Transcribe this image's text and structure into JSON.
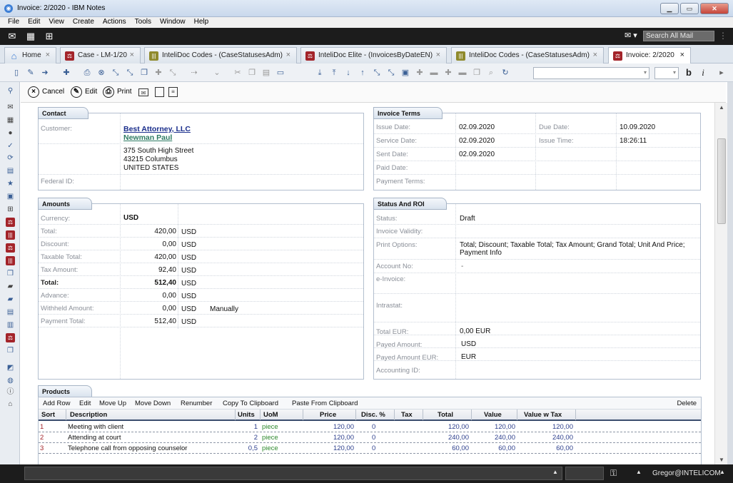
{
  "window": {
    "title": "Invoice: 2/2020 - IBM Notes",
    "buttons": [
      "▁",
      "▭",
      "✕"
    ]
  },
  "menu": [
    "File",
    "Edit",
    "View",
    "Create",
    "Actions",
    "Tools",
    "Window",
    "Help"
  ],
  "search": {
    "placeholder": "Search All Mail"
  },
  "tabs": [
    {
      "label": "Home",
      "icon": "home-icon"
    },
    {
      "label": "Case - LM-1/20",
      "icon": "case-icon"
    },
    {
      "label": "InteliDoc Codes - (CaseStatusesAdm)",
      "icon": "intelidoc-codes-icon"
    },
    {
      "label": "InteliDoc Elite - (InvoicesByDateEN)",
      "icon": "intelidoc-elite-icon"
    },
    {
      "label": "InteliDoc Codes - (CaseStatusesAdm)",
      "icon": "intelidoc-codes-icon"
    },
    {
      "label": "Invoice: 2/2020",
      "icon": "invoice-icon",
      "active": true
    }
  ],
  "format": {
    "bold": "b",
    "italic": "i"
  },
  "actions": {
    "cancel": "Cancel",
    "edit": "Edit",
    "print": "Print"
  },
  "contact": {
    "title": "Contact",
    "customer_label": "Customer:",
    "company": "Best Attorney, LLC",
    "person": "Newman Paul",
    "address1": "375 South High Street",
    "address2": "43215  Columbus",
    "country": "UNITED STATES",
    "federal_label": "Federal ID:"
  },
  "invoice_terms": {
    "title": "Invoice Terms",
    "issue_date_label": "Issue Date:",
    "issue_date": "02.09.2020",
    "due_date_label": "Due Date:",
    "due_date": "10.09.2020",
    "service_date_label": "Service Date:",
    "service_date": "02.09.2020",
    "issue_time_label": "Issue Time:",
    "issue_time": "18:26:11",
    "sent_date_label": "Sent Date:",
    "sent_date": "02.09.2020",
    "paid_date_label": "Paid Date:",
    "payment_terms_label": "Payment Terms:"
  },
  "amounts": {
    "title": "Amounts",
    "currency_label": "Currency:",
    "currency": "USD",
    "rows": [
      {
        "label": "Total:",
        "value": "420,00",
        "cur": "USD",
        "bold": false
      },
      {
        "label": "Discount:",
        "value": "0,00",
        "cur": "USD",
        "bold": false
      },
      {
        "label": "Taxable Total:",
        "value": "420,00",
        "cur": "USD",
        "bold": false
      },
      {
        "label": "Tax Amount:",
        "value": "92,40",
        "cur": "USD",
        "bold": false
      },
      {
        "label": "Total:",
        "value": "512,40",
        "cur": "USD",
        "bold": true
      },
      {
        "label": "Advance:",
        "value": "0,00",
        "cur": "USD",
        "bold": false
      },
      {
        "label": "Withheld Amount:",
        "value": "0,00",
        "cur": "USD",
        "bold": false,
        "note": "Manually"
      },
      {
        "label": "Payment Total:",
        "value": "512,40",
        "cur": "USD",
        "bold": false
      }
    ]
  },
  "status": {
    "title": "Status And ROI",
    "status_label": "Status:",
    "status": "Draft",
    "validity_label": "Invoice Validity:",
    "print_label": "Print Options:",
    "print_options": "Total; Discount; Taxable Total; Tax Amount; Grand Total; Unit And Price; Payment Info",
    "account_label": "Account No:",
    "account": "-",
    "einvoice_label": "e-Invoice:",
    "intrastat_label": "Intrastat:",
    "total_eur_label": "Total EUR:",
    "total_eur": "0,00 EUR",
    "payed_label": "Payed Amount:",
    "payed": "USD",
    "payed_eur_label": "Payed Amount EUR:",
    "payed_eur": "EUR",
    "accounting_label": "Accounting ID:"
  },
  "products": {
    "title": "Products",
    "tools": [
      "Add Row",
      "Edit",
      "Move Up",
      "Move Down",
      "Renumber",
      "Copy To Clipboard",
      "Paste From Clipboard"
    ],
    "delete": "Delete",
    "columns": [
      "Sort",
      "Description",
      "Units",
      "UoM",
      "Price",
      "Disc. %",
      "Tax",
      "Total",
      "Value",
      "Value w Tax"
    ],
    "rows": [
      {
        "sort": "1",
        "desc": "Meeting with client",
        "units": "1",
        "uom": "piece",
        "price": "120,00",
        "disc": "0",
        "tax": "",
        "total": "120,00",
        "value": "120,00",
        "vwt": "120,00"
      },
      {
        "sort": "2",
        "desc": "Attending at court",
        "units": "2",
        "uom": "piece",
        "price": "120,00",
        "disc": "0",
        "tax": "",
        "total": "240,00",
        "value": "240,00",
        "vwt": "240,00"
      },
      {
        "sort": "3",
        "desc": "Telephone call from opposing counselor",
        "units": "0,5",
        "uom": "piece",
        "price": "120,00",
        "disc": "0",
        "tax": "",
        "total": "60,00",
        "value": "60,00",
        "vwt": "60,00"
      }
    ]
  },
  "statusbar": {
    "user": "Gregor@INTELICOM"
  }
}
